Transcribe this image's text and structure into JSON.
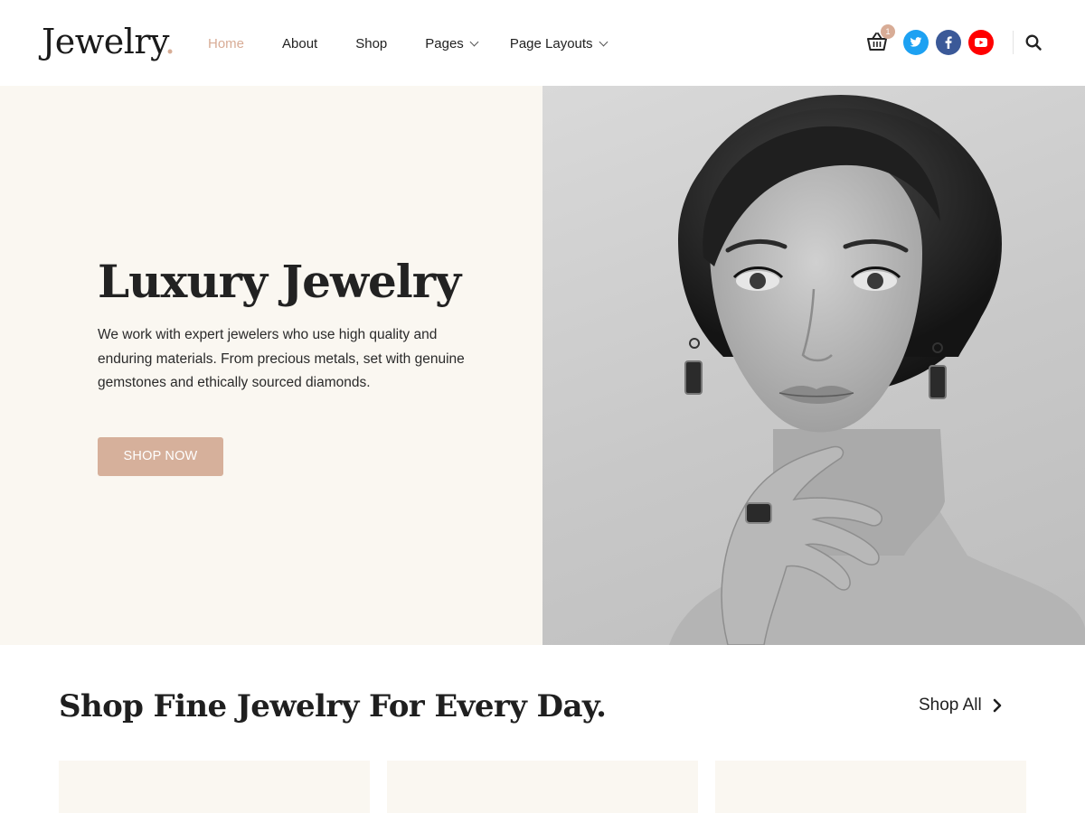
{
  "header": {
    "logo": {
      "text": "Jewelry",
      "dot": "."
    },
    "nav": [
      {
        "label": "Home",
        "active": true
      },
      {
        "label": "About"
      },
      {
        "label": "Shop"
      },
      {
        "label": "Pages",
        "dropdown": true
      },
      {
        "label": "Page Layouts",
        "dropdown": true
      }
    ],
    "cart": {
      "icon": "basket-icon",
      "count": "1"
    },
    "social": [
      "twitter-icon",
      "facebook-icon",
      "youtube-icon"
    ],
    "search_icon": "search-icon"
  },
  "hero": {
    "title": "Luxury Jewelry",
    "text": "We work with expert jewelers who use high quality and enduring materials. From precious metals, set with genuine gemstones and ethically sourced diamonds.",
    "button": "SHOP NOW",
    "image": "black-and-white-portrait-woman-with-earrings"
  },
  "section": {
    "title": "Shop Fine Jewelry For Every Day.",
    "link": "Shop All",
    "cards": [
      {
        "name": "product-card-1"
      },
      {
        "name": "product-card-2"
      },
      {
        "name": "product-card-3"
      }
    ]
  },
  "colors": {
    "accent": "#d8ac96",
    "button": "#d6b09b",
    "hero_bg": "#faf7f1",
    "twitter": "#1da1f2",
    "facebook": "#3b5998",
    "youtube": "#ff0000"
  }
}
